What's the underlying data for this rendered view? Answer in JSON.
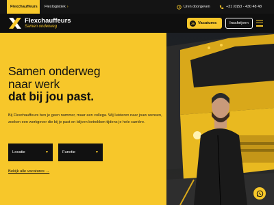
{
  "topbar": {
    "tabs": [
      {
        "label": "Flexchauffeurs"
      },
      {
        "label": "Flexlogistiek",
        "chevron": "›"
      }
    ],
    "hours_label": "Uren doorgeven",
    "phone": "+31 (0)53 - 430 48 48"
  },
  "header": {
    "logo_name": "Flexchauffeurs",
    "logo_tagline": "Samen onderweg",
    "vacatures_count": "35",
    "vacatures_label": "Vacatures",
    "inschrijven_label": "Inschrijven"
  },
  "hero": {
    "title_line1": "Samen onderweg",
    "title_line2": "naar werk",
    "title_line3": "dat bij jou past.",
    "intro": "Bij Flexchauffeurs ben je geen nummer, maar een collega. Wij luisteren naar jouw wensen, zoeken een werkgever die bij je past en blijven betrokken tijdens je hele carrière.",
    "filters": [
      {
        "label": "Locatie",
        "caret": "▼"
      },
      {
        "label": "Functie",
        "caret": "▼"
      }
    ],
    "all_link": "Bekijk alle vacatures →"
  },
  "colors": {
    "accent": "#f7c72a",
    "dark": "#111111"
  },
  "icons": [
    "clock-icon",
    "phone-icon",
    "menu-icon",
    "whatsapp-icon",
    "logo-mark-icon"
  ]
}
